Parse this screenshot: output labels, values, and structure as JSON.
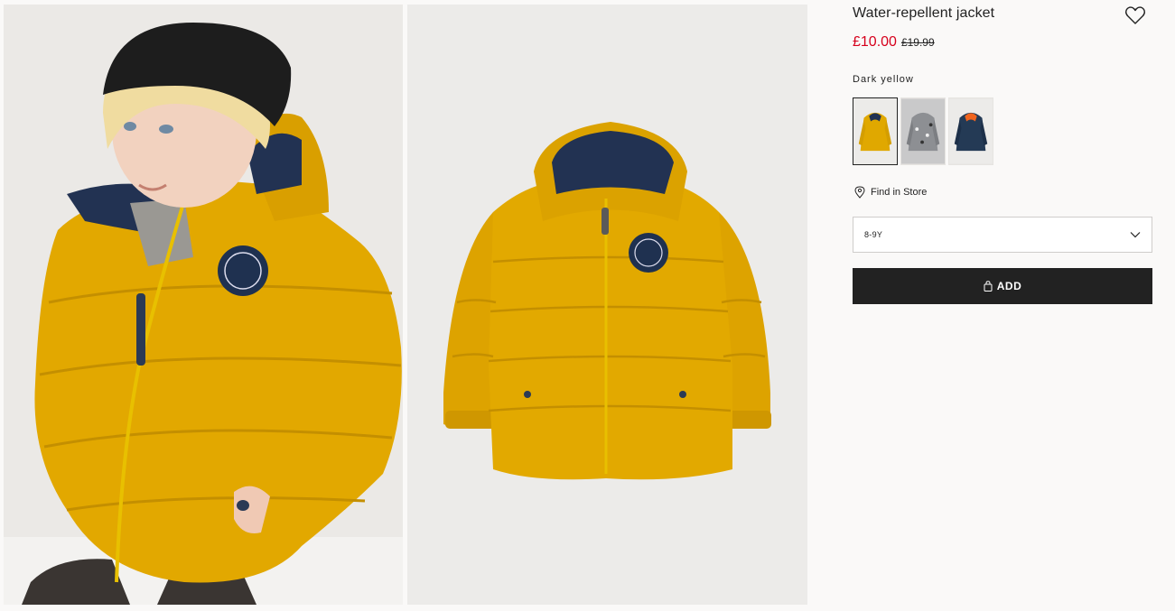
{
  "product": {
    "title": "Water-repellent jacket",
    "price_current": "£10.00",
    "price_original": "£19.99"
  },
  "colors": {
    "selected_label": "Dark yellow",
    "swatches": [
      {
        "name": "dark-yellow",
        "color": "#d9a300"
      },
      {
        "name": "grey-pattern",
        "color": "#8d8f93"
      },
      {
        "name": "navy-blue",
        "color": "#243a55"
      }
    ]
  },
  "store": {
    "find_label": "Find in Store",
    "icon": "location-pin-icon"
  },
  "size": {
    "selected": "8-9Y",
    "icon": "chevron-down-icon"
  },
  "cart": {
    "add_label": "ADD",
    "icon": "shopping-bag-icon"
  },
  "favourite": {
    "icon": "heart-icon"
  },
  "theme": {
    "sale_red": "#d6001c",
    "button_dark": "#222222",
    "jacket_yellow": "#e0a800"
  }
}
